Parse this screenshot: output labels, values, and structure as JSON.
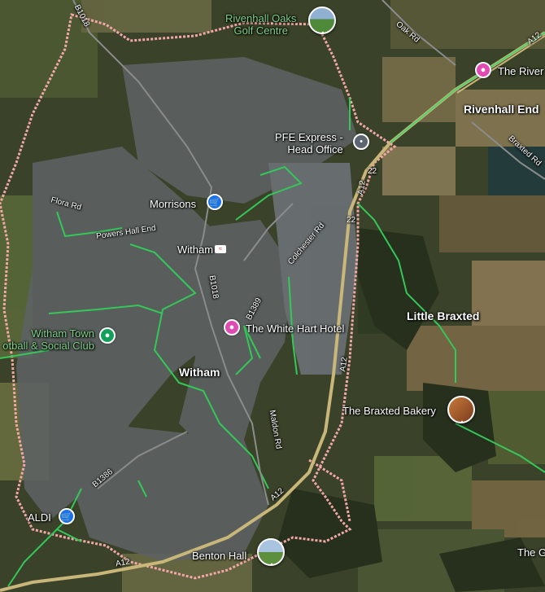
{
  "map": {
    "places": {
      "rivenhall_oaks": "Rivenhall Oaks\nGolf Centre",
      "rivenhall_end": "Rivenhall End",
      "the_river": "The River",
      "pfe_express": "PFE Express -\nHead Office",
      "morrisons": "Morrisons",
      "witham_station": "Witham",
      "witham_town": "Witham",
      "white_hart": "The White Hart Hotel",
      "witham_town_fc": "Witham Town\notball & Social Club",
      "little_braxted": "Little Braxted",
      "braxted_bakery": "The Braxted Bakery",
      "aldi": "ALDI",
      "benton_hall": "Benton Hall",
      "the_g": "The G"
    },
    "roads": {
      "b1018_north": "B1018",
      "oak_rd": "Oak Rd",
      "a12_ne": "A12",
      "braxted_rd": "Braxted Rd",
      "flora_rd": "Flora Rd",
      "powers_hall_end": "Powers Hall End",
      "colchester_rd": "Colchester Rd",
      "a12_mid": "A12",
      "b1389": "B1389",
      "b1018_mid": "B1018",
      "maldon_rd": "Maldon Rd",
      "b1386": "B1386",
      "a12_south": "A12",
      "a12_sw": "A12",
      "j22a": "22",
      "j22b": "22"
    },
    "icons": {
      "hotel": "hotel-icon",
      "shop": "shopping-cart-icon",
      "place": "place-icon",
      "station": "train-station-icon"
    },
    "colors": {
      "hotel_pin": "#e04ab2",
      "shop_pin": "#1a73e8",
      "place_pin": "#13a05a",
      "boundary": "#f3a8a8",
      "trail": "#34c759",
      "motorway": "#c9b77a"
    }
  }
}
